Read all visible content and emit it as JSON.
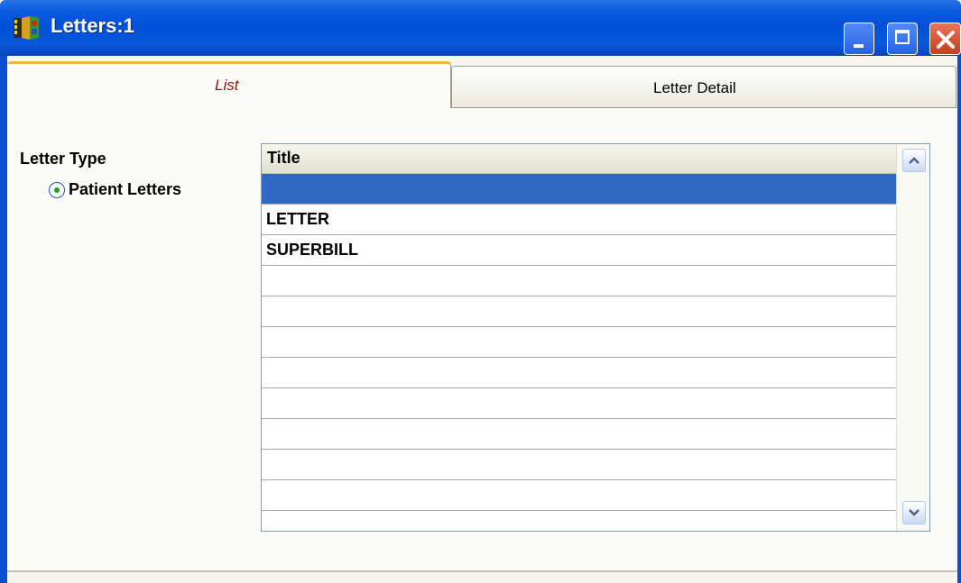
{
  "window": {
    "title": "Letters:1"
  },
  "tabs": [
    {
      "label": "List",
      "selected": true
    },
    {
      "label": "Letter Detail",
      "selected": false
    }
  ],
  "letter_type": {
    "label": "Letter Type",
    "options": [
      {
        "label": "Patient Letters",
        "checked": true
      }
    ]
  },
  "grid": {
    "column_header": "Title",
    "rows": [
      "",
      "LETTER",
      "SUPERBILL",
      "",
      "",
      "",
      "",
      "",
      "",
      "",
      ""
    ],
    "selected_index": 0
  },
  "colors": {
    "titlebar": "#0050d8",
    "selection": "#316ac5",
    "active_tab_accent": "#f2b640",
    "active_tab_text": "#a01010"
  }
}
